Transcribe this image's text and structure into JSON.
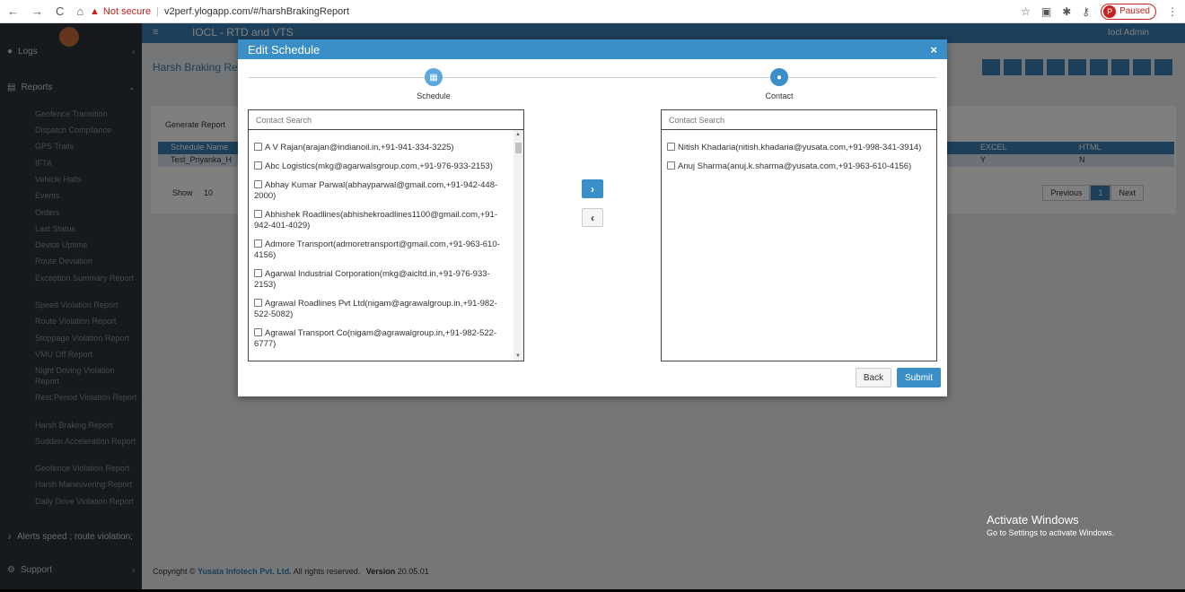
{
  "browser": {
    "not_secure": "Not secure",
    "url": "v2perf.ylogapp.com/#/harshBrakingReport",
    "paused": "Paused",
    "profile_initial": "P"
  },
  "app": {
    "title": "IOCL - RTD and VTS",
    "user": "Iocl Admin",
    "page_title": "Harsh Braking Rep",
    "generate_tab": "Generate Report",
    "table": {
      "headers": [
        "Schedule Name",
        "EXCEL",
        "HTML"
      ],
      "row": [
        "Test_Priyanka_H",
        "Y",
        "N"
      ]
    },
    "show_label": "Show",
    "show_value": "10",
    "pager": [
      "Previous",
      "1",
      "Next"
    ],
    "footer_copyright": "Copyright ©",
    "footer_brand": "Yusata Infotech Pvt. Ltd.",
    "footer_rights": "All rights reserved.",
    "footer_version_label": "Version",
    "footer_version": "20.05.01"
  },
  "sidebar": {
    "logs": "Logs",
    "reports": "Reports",
    "items": [
      "Geofence Transition",
      "Dispatch Compliance",
      "GPS Trails",
      "IFTA",
      "Vehicle Halts",
      "Events",
      "Orders",
      "Last Status",
      "Device Uptime",
      "Route Deviation",
      "Exception Summary Report",
      "Speed Violation Report",
      "Route Violation Report",
      "Stoppage Violation Report",
      "VMU Off Report",
      "Night Driving Violation Report",
      "Rest Period Violation Report",
      "Harsh Braking Report",
      "Sudden Acceleration Report",
      "Geofence Violation Report",
      "Harsh Maneuvering Report",
      "Daily Drive Violation Report"
    ],
    "alerts": "Alerts speed ; route violation;",
    "support": "Support"
  },
  "modal": {
    "title": "Edit Schedule",
    "steps": [
      "Schedule",
      "Contact"
    ],
    "left_placeholder": "Contact Search",
    "right_placeholder": "Contact Search",
    "left_items": [
      "A V Rajan(arajan@indianoil.in,+91-941-334-3225)",
      "Abc Logistics(mkg@agarwalsgroup.com,+91-976-933-2153)",
      "Abhay Kumar Parwal(abhayparwal@gmail.com,+91-942-448-2000)",
      "Abhishek Roadlines(abhishekroadlines1100@gmail.com,+91-942-401-4029)",
      "Admore Transport(admoretransport@gmail.com,+91-963-610-4156)",
      "Agarwal Industrial Corporation(mkg@aicltd.in,+91-976-933-2153)",
      "Agrawal Roadlines Pvt Ltd(nigam@agrawalgroup.in,+91-982-522-5082)",
      "Agrawal Transport Co(nigam@agrawalgroup.in,+91-982-522-6777)"
    ],
    "right_items": [
      "Nitish Khadaria(nitish.khadaria@yusata.com,+91-998-341-3914)",
      "Anuj Sharma(anuj.k.sharma@yusata.com,+91-963-610-4156)"
    ],
    "back_label": "Back",
    "submit_label": "Submit",
    "colors": {
      "header": "#3a8fc8",
      "primary": "#3a8fc8",
      "step_icon": "#5aa8dc"
    }
  },
  "watermark": {
    "title": "Activate Windows",
    "subtitle": "Go to Settings to activate Windows."
  }
}
